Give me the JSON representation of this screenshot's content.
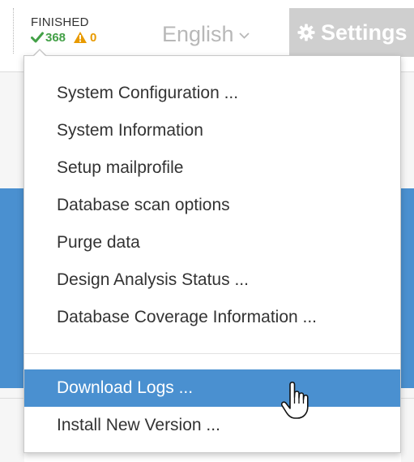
{
  "header": {
    "status_title": "FINISHED",
    "ok_count": "368",
    "warning_count": "0",
    "language": "English",
    "settings_label": "Settings"
  },
  "menu": {
    "items": [
      {
        "label": "System Configuration ..."
      },
      {
        "label": "System Information"
      },
      {
        "label": "Setup mailprofile"
      },
      {
        "label": "Database scan options"
      },
      {
        "label": "Purge data"
      },
      {
        "label": "Design Analysis Status ..."
      },
      {
        "label": "Database Coverage Information ..."
      }
    ],
    "items_after_separator": [
      {
        "label": "Download Logs ...",
        "active": true
      },
      {
        "label": "Install New Version ..."
      }
    ]
  },
  "icons": {
    "ok": "check-icon",
    "warning": "warning-triangle-icon",
    "language_dropdown": "chevron-down-icon",
    "settings": "gear-icon",
    "cursor": "hand-pointer-icon"
  },
  "colors": {
    "accent_blue": "#4a90d0",
    "ok_green": "#43a047",
    "warning_amber": "#e89a00",
    "settings_button_bg": "#cfcfcf",
    "language_text": "#b8b8b8"
  }
}
